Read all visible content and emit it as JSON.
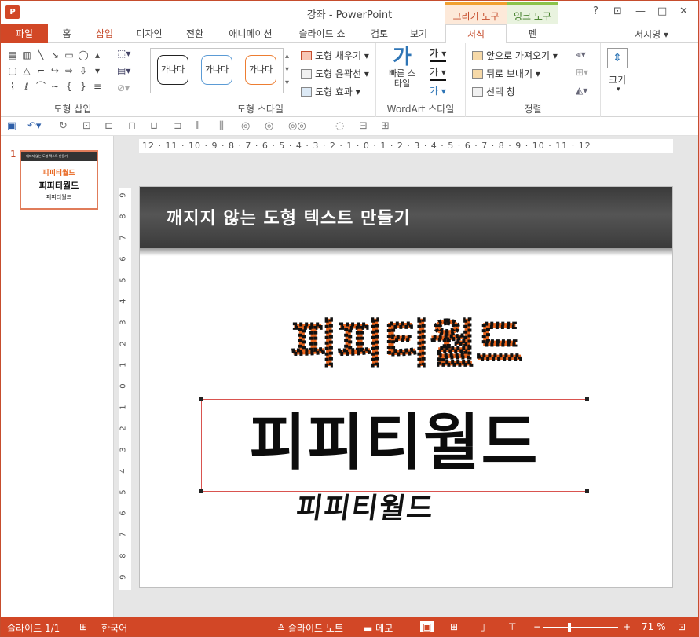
{
  "window": {
    "title": "강좌 - PowerPoint",
    "app_icon": "P",
    "context_tabs": [
      "그리기 도구",
      "잉크 도구"
    ],
    "controls": [
      "?",
      "⊡",
      "—",
      "□",
      "✕"
    ]
  },
  "tabs": {
    "file": "파일",
    "items": [
      "홈",
      "삽입",
      "디자인",
      "전환",
      "애니메이션",
      "슬라이드 쇼",
      "검토",
      "보기",
      "서식",
      "펜"
    ],
    "active": "서식",
    "user": "서지영"
  },
  "ribbon": {
    "groups": {
      "insert_shapes": "도형 삽입",
      "shape_styles": "도형 스타일",
      "wordart_styles": "WordArt 스타일",
      "arrange": "정렬",
      "size": "크기"
    },
    "style_samples": [
      "가나다",
      "가나다",
      "가나다"
    ],
    "shape_fill": "도형 채우기",
    "shape_outline": "도형 윤곽선",
    "shape_effects": "도형 효과",
    "quick_styles": "빠른 스타일",
    "bring_forward": "앞으로 가져오기",
    "send_backward": "뒤로 보내기",
    "selection_pane": "선택 창",
    "size_label": "크기",
    "text_glyph": "가"
  },
  "slides_pane": {
    "number": "1",
    "thumb_title": "깨지지 않는 도형 텍스트 만들기",
    "thumb_lines": [
      "피피티월드",
      "피피티월드",
      "피피티월드"
    ]
  },
  "rulers": {
    "horizontal": "12 · 11 · 10 · 9 · 8 · 7 · 6 · 5 · 4 · 3 · 2 · 1 · 0 · 1 · 2 · 3 · 4 · 5 · 6 · 7 · 8 · 9 · 10 · 11 · 12",
    "vertical": [
      "9",
      "8",
      "7",
      "6",
      "5",
      "4",
      "3",
      "2",
      "1",
      "0",
      "1",
      "2",
      "3",
      "4",
      "5",
      "6",
      "7",
      "8",
      "9"
    ]
  },
  "slide": {
    "title": "깨지지 않는 도형 텍스트 만들기",
    "wordart_text": "피피티월드",
    "big_text": "피피티월드",
    "brush_text": "피피티월드"
  },
  "statusbar": {
    "slide": "슬라이드 1/1",
    "language": "한국어",
    "notes": "슬라이드 노트",
    "comments": "메모",
    "zoom": "71 %",
    "minus": "−",
    "plus": "+"
  },
  "colors": {
    "accent": "#d24726",
    "wordart_fill": "#e8641c"
  }
}
